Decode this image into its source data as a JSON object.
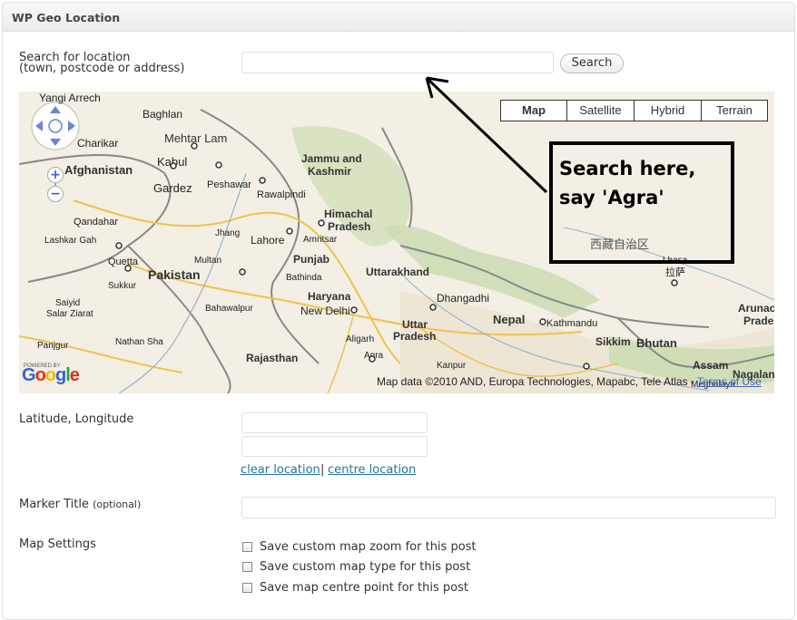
{
  "panel": {
    "title": "WP Geo Location"
  },
  "search": {
    "label_line1": "Search for location",
    "label_line2": "(town, postcode or address)",
    "input_value": "",
    "button_label": "Search"
  },
  "map": {
    "types": [
      "Map",
      "Satellite",
      "Hybrid",
      "Terrain"
    ],
    "selected_type": "Map",
    "attribution": "Map data ©2010 AND, Europa Technologies, Mapabc, Tele Atlas - ",
    "terms_label": "Terms of Use",
    "google_letters": [
      "G",
      "o",
      "o",
      "g",
      "l",
      "e"
    ],
    "google_colors": [
      "#3366cc",
      "#dd3322",
      "#eebb00",
      "#3366cc",
      "#22aa44",
      "#dd3322"
    ],
    "powered_by": "POWERED BY",
    "zoom_in": "+",
    "zoom_out": "−",
    "places": [
      {
        "name": "Yangi Arrech",
        "bold": false
      },
      {
        "name": "Baghlan",
        "bold": false
      },
      {
        "name": "Mehtar Lam",
        "bold": false
      },
      {
        "name": "Charikar",
        "bold": false
      },
      {
        "name": "Kabul",
        "bold": false
      },
      {
        "name": "Afghanistan",
        "bold": true
      },
      {
        "name": "Gardez",
        "bold": false
      },
      {
        "name": "Peshawar",
        "bold": false
      },
      {
        "name": "Rawalpindi",
        "bold": false
      },
      {
        "name": "Jammu and",
        "bold": true
      },
      {
        "name": "Kashmir",
        "bold": true
      },
      {
        "name": "Qandahar",
        "bold": false
      },
      {
        "name": "Himachal",
        "bold": true
      },
      {
        "name": "Pradesh",
        "bold": true
      },
      {
        "name": "Lashkar Gah",
        "bold": false
      },
      {
        "name": "Quetta",
        "bold": false
      },
      {
        "name": "Jhang",
        "bold": false
      },
      {
        "name": "Lahore",
        "bold": false
      },
      {
        "name": "Amritsar",
        "bold": false
      },
      {
        "name": "Pakistan",
        "bold": true
      },
      {
        "name": "Multan",
        "bold": false
      },
      {
        "name": "Punjab",
        "bold": true
      },
      {
        "name": "Bathinda",
        "bold": false
      },
      {
        "name": "Uttarakhand",
        "bold": true
      },
      {
        "name": "Dhangadhi",
        "bold": false
      },
      {
        "name": "Bahawalpur",
        "bold": false
      },
      {
        "name": "Haryana",
        "bold": true
      },
      {
        "name": "New Delhi",
        "bold": false
      },
      {
        "name": "Sukkur",
        "bold": false
      },
      {
        "name": "Salar Ziarat",
        "bold": false
      },
      {
        "name": "Panjgur",
        "bold": false
      },
      {
        "name": "Nathan Sha",
        "bold": false
      },
      {
        "name": "Uttar",
        "bold": true
      },
      {
        "name": "Pradesh",
        "bold": true
      },
      {
        "name": "Nepal",
        "bold": true
      },
      {
        "name": "Kathmandu",
        "bold": false
      },
      {
        "name": "Aligarh",
        "bold": false
      },
      {
        "name": "Rajasthan",
        "bold": true
      },
      {
        "name": "Agra",
        "bold": false
      },
      {
        "name": "Kanpur",
        "bold": false
      },
      {
        "name": "Sikkim",
        "bold": true
      },
      {
        "name": "Bhutan",
        "bold": true
      },
      {
        "name": "Assam",
        "bold": true
      },
      {
        "name": "Arunac",
        "bold": true
      },
      {
        "name": "Prades",
        "bold": true
      },
      {
        "name": "Nagalan",
        "bold": true
      },
      {
        "name": "Meghalaya",
        "bold": false
      },
      {
        "name": "西藏自治区",
        "bold": false
      },
      {
        "name": "拉萨",
        "bold": false
      },
      {
        "name": "Lhasa",
        "bold": false
      },
      {
        "name": "Saiyid",
        "bold": false
      }
    ]
  },
  "annotation": {
    "callout_text": "Search here, say 'Agra'"
  },
  "latlng": {
    "label": "Latitude, Longitude",
    "lat_value": "",
    "lng_value": ""
  },
  "links": {
    "clear": "clear location",
    "separator": "|",
    "centre": "centre location"
  },
  "marker": {
    "label": "Marker Title",
    "optional": "(optional)",
    "value": ""
  },
  "settings": {
    "label": "Map Settings",
    "options": [
      {
        "label": "Save custom map zoom for this post",
        "checked": false
      },
      {
        "label": "Save custom map type for this post",
        "checked": false
      },
      {
        "label": "Save map centre point for this post",
        "checked": false
      }
    ]
  }
}
